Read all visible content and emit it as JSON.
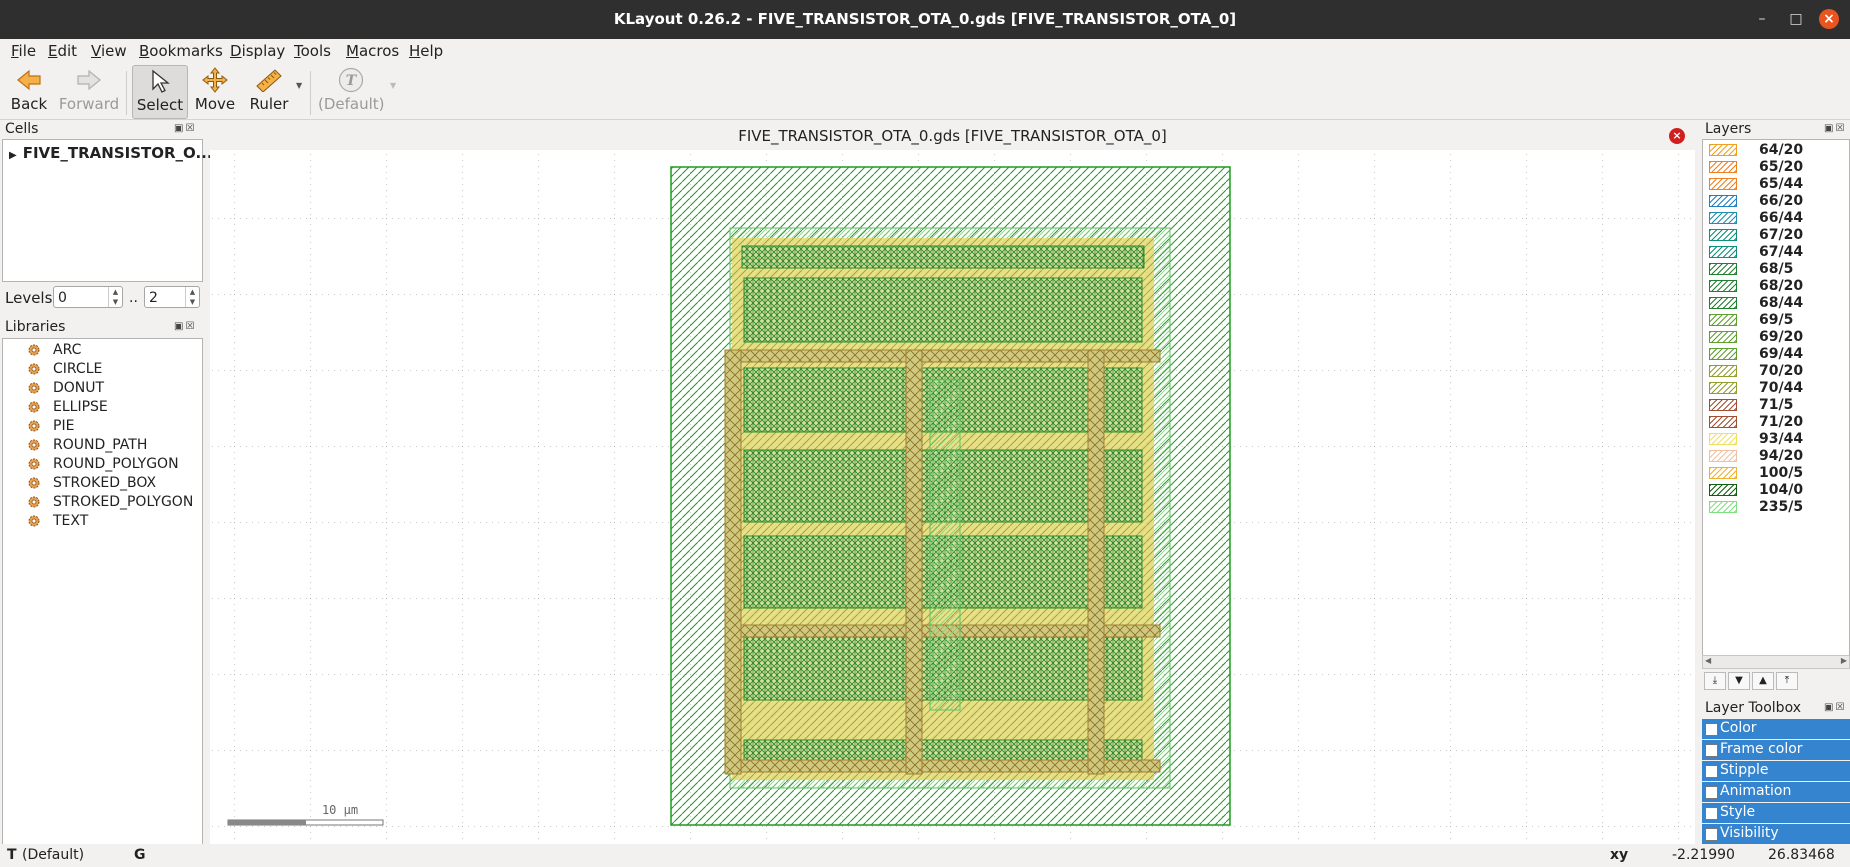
{
  "window": {
    "title": "KLayout 0.26.2 - FIVE_TRANSISTOR_OTA_0.gds [FIVE_TRANSISTOR_OTA_0]"
  },
  "menu": [
    {
      "pre": "",
      "u": "F",
      "post": "ile"
    },
    {
      "pre": "",
      "u": "E",
      "post": "dit"
    },
    {
      "pre": "",
      "u": "V",
      "post": "iew"
    },
    {
      "pre": "",
      "u": "B",
      "post": "ookmarks"
    },
    {
      "pre": "",
      "u": "D",
      "post": "isplay"
    },
    {
      "pre": "",
      "u": "T",
      "post": "ools"
    },
    {
      "pre": "",
      "u": "M",
      "post": "acros"
    },
    {
      "pre": "",
      "u": "H",
      "post": "elp"
    }
  ],
  "toolbar": {
    "back": "Back",
    "forward": "Forward",
    "select": "Select",
    "move": "Move",
    "ruler": "Ruler",
    "default": "(Default)"
  },
  "cells": {
    "title": "Cells",
    "top_cell": "FIVE_TRANSISTOR_O..."
  },
  "levels": {
    "label": "Levels",
    "from": "0",
    "sep": "..",
    "to": "2"
  },
  "libraries": {
    "title": "Libraries",
    "items": [
      "ARC",
      "CIRCLE",
      "DONUT",
      "ELLIPSE",
      "PIE",
      "ROUND_PATH",
      "ROUND_POLYGON",
      "STROKED_BOX",
      "STROKED_POLYGON",
      "TEXT"
    ]
  },
  "viewport": {
    "title": "FIVE_TRANSISTOR_OTA_0.gds [FIVE_TRANSISTOR_OTA_0]",
    "scale_label": "10 µm"
  },
  "layers": {
    "title": "Layers",
    "items": [
      {
        "name": "64/20",
        "color": "#f0a020"
      },
      {
        "name": "65/20",
        "color": "#f08020"
      },
      {
        "name": "65/44",
        "color": "#f08020"
      },
      {
        "name": "66/20",
        "color": "#2080c0"
      },
      {
        "name": "66/44",
        "color": "#2090b0"
      },
      {
        "name": "67/20",
        "color": "#10907a"
      },
      {
        "name": "67/44",
        "color": "#10907a"
      },
      {
        "name": "68/5",
        "color": "#208030"
      },
      {
        "name": "68/20",
        "color": "#208030"
      },
      {
        "name": "68/44",
        "color": "#208030"
      },
      {
        "name": "69/5",
        "color": "#60a030"
      },
      {
        "name": "69/20",
        "color": "#60a030"
      },
      {
        "name": "69/44",
        "color": "#60a030"
      },
      {
        "name": "70/20",
        "color": "#90a030"
      },
      {
        "name": "70/44",
        "color": "#90a030"
      },
      {
        "name": "71/5",
        "color": "#a05030"
      },
      {
        "name": "71/20",
        "color": "#a05030"
      },
      {
        "name": "93/44",
        "color": "#f0e060"
      },
      {
        "name": "94/20",
        "color": "#f0c0a0"
      },
      {
        "name": "100/5",
        "color": "#f0b030"
      },
      {
        "name": "104/0",
        "color": "#106010"
      },
      {
        "name": "235/5",
        "color": "#80e080"
      }
    ]
  },
  "layer_toolbox": {
    "title": "Layer Toolbox",
    "items": [
      "Color",
      "Frame color",
      "Stipple",
      "Animation",
      "Style",
      "Visibility"
    ]
  },
  "status": {
    "mode_key": "T",
    "mode_value": "(Default)",
    "grid_key": "G",
    "coord_label": "xy",
    "x": "-2.21990",
    "y": "26.83468"
  },
  "colors": {
    "titlebar": "#2f2f2f",
    "selection": "#3584cf",
    "close": "#e95420",
    "layout_green": "#1e9a1e",
    "layout_yellow": "#e8d860"
  }
}
